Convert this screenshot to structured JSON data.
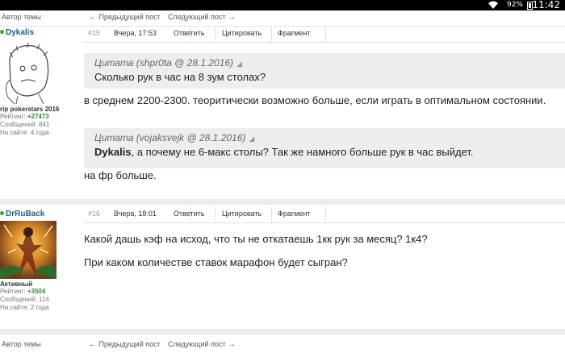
{
  "status_bar": {
    "battery": "92%",
    "time": "11:42"
  },
  "nav": {
    "author_label": "Автор темы",
    "prev_label": "Предыдущий пост",
    "next_label": "Следующий пост"
  },
  "posts": [
    {
      "user": {
        "name": "Dykalis",
        "title": "rip pokerstars 2016",
        "rating_label": "Рейтинг:",
        "rating": "+27473",
        "messages": "Сообщений: 841",
        "on_site": "На сайте: 4 года"
      },
      "number": "#15",
      "date": "Вчера, 17:53",
      "actions": {
        "reply": "Ответить",
        "quote": "Цитировать",
        "fragment": "Фрагмент"
      },
      "quote1": {
        "title": "Цитата (shpr0ta @ 28.1.2016)",
        "text": "Сколько рук в час на 8 зум столах?"
      },
      "text1": "в среднем 2200-2300. теоритически возможно больше, если играть в оптимальном состоянии.",
      "quote2": {
        "title": "Цитата (vojaksvejk @ 28.1.2016)",
        "bold": "Dykalis",
        "text": ", а почему не 6-макс столы? Так же намного больше рук в час выйдет."
      },
      "text2": "на фр больше."
    },
    {
      "user": {
        "name": "DrRuBack",
        "title": "Активный",
        "rating_label": "Рейтинг:",
        "rating": "+3504",
        "messages": "Сообщений: 114",
        "on_site": "На сайте: 2 года"
      },
      "number": "#16",
      "date": "Вчера, 18:01",
      "actions": {
        "reply": "Ответить",
        "quote": "Цитировать",
        "fragment": "Фрагмент"
      },
      "text1": "Какой дашь кэф на исход, что ты не откатаешь 1кк рук за месяц? 1к4?",
      "text2": "При каком количестве ставок марафон будет сыгран?"
    }
  ]
}
